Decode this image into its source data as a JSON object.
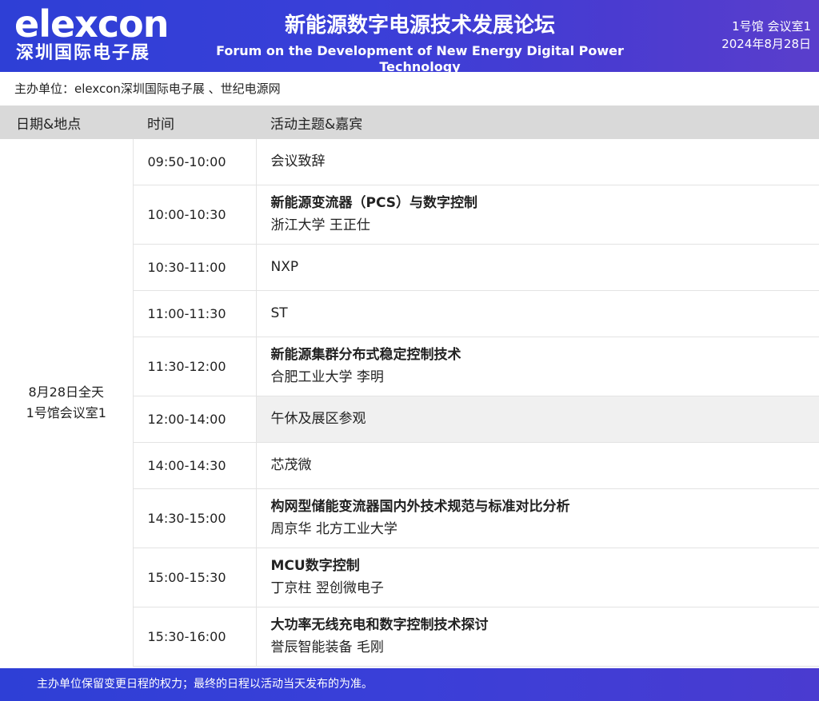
{
  "header": {
    "logo_en": "elexcon",
    "logo_cn": "深圳国际电子展",
    "title_cn": "新能源数字电源技术发展论坛",
    "title_en": "Forum on the Development of New Energy Digital Power Technology",
    "venue": "1号馆  会议室1",
    "date": "2024年8月28日"
  },
  "organizer": "主办单位：elexcon深圳国际电子展 、世纪电源网",
  "table": {
    "headers": [
      "日期&地点",
      "时间",
      "活动主题&嘉宾"
    ],
    "date_line1": "8月28日全天",
    "date_line2": "1号馆会议室1",
    "rows": [
      {
        "time": "09:50-10:00",
        "title": "会议致辞",
        "speaker": ""
      },
      {
        "time": "10:00-10:30",
        "title": "新能源变流器（PCS）与数字控制",
        "speaker": "浙江大学 王正仕"
      },
      {
        "time": "10:30-11:00",
        "title": "NXP",
        "speaker": ""
      },
      {
        "time": "11:00-11:30",
        "title": "ST",
        "speaker": ""
      },
      {
        "time": "11:30-12:00",
        "title": "新能源集群分布式稳定控制技术",
        "speaker": "合肥工业大学 李明"
      },
      {
        "time": "12:00-14:00",
        "title": "午休及展区参观",
        "speaker": ""
      },
      {
        "time": "14:00-14:30",
        "title": "芯茂微",
        "speaker": ""
      },
      {
        "time": "14:30-15:00",
        "title": "构网型储能变流器国内外技术规范与标准对比分析",
        "speaker": "周京华  北方工业大学"
      },
      {
        "time": "15:00-15:30",
        "title": "MCU数字控制",
        "speaker": "丁京柱  翌创微电子"
      },
      {
        "time": "15:30-16:00",
        "title": "大功率无线充电和数字控制技术探讨",
        "speaker": "誉辰智能装备 毛刚"
      }
    ]
  },
  "footer": "主办单位保留变更日程的权力；最终的日程以活动当天发布的为准。",
  "colors": {
    "header_blue": "#3a3fd8",
    "table_header_gray": "#d9d9d9",
    "break_row_gray": "#f0f0f0"
  }
}
